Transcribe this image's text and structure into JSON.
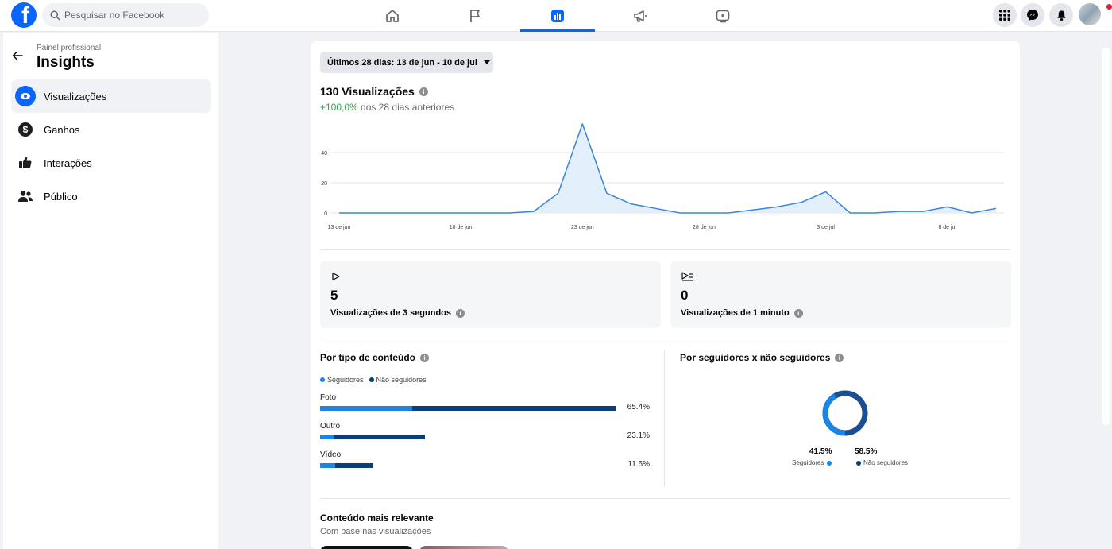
{
  "topbar": {
    "search_placeholder": "Pesquisar no Facebook",
    "tabs": [
      {
        "icon": "home-icon"
      },
      {
        "icon": "flag-icon"
      },
      {
        "icon": "insights-icon",
        "active": true
      },
      {
        "icon": "megaphone-icon"
      },
      {
        "icon": "video-icon"
      }
    ],
    "right": [
      "menu-grid-icon",
      "messenger-icon",
      "bell-icon",
      "avatar"
    ]
  },
  "sidebar": {
    "kicker": "Painel profissional",
    "title": "Insights",
    "items": [
      {
        "label": "Visualizações",
        "icon": "eye-icon",
        "active": true
      },
      {
        "label": "Ganhos",
        "icon": "dollar-icon"
      },
      {
        "label": "Interações",
        "icon": "thumbs-up-icon"
      },
      {
        "label": "Público",
        "icon": "people-icon"
      }
    ]
  },
  "main": {
    "range_label": "Últimos 28 dias: 13 de jun - 10 de jul",
    "views_title": "130 Visualizações",
    "views_change": "+100,0%",
    "views_change_suffix": " dos 28 dias anteriores",
    "stats": [
      {
        "value": "5",
        "label": "Visualizações de 3 segundos",
        "icon": "play-icon"
      },
      {
        "value": "0",
        "label": "Visualizações de 1 minuto",
        "icon": "play-list-icon"
      }
    ],
    "content_type": {
      "title": "Por tipo de conteúdo",
      "legend": [
        "Seguidores",
        "Não seguidores"
      ],
      "rows": [
        {
          "label": "Foto",
          "pct": "65.4%",
          "total": 0.654,
          "followers_share": 0.31
        },
        {
          "label": "Outro",
          "pct": "23.1%",
          "total": 0.231,
          "followers_share": 0.14
        },
        {
          "label": "Vídeo",
          "pct": "11.6%",
          "total": 0.116,
          "followers_share": 0.28
        }
      ]
    },
    "followers": {
      "title": "Por seguidores x não seguidores",
      "followers_pct": "41.5%",
      "non_followers_pct": "58.5%",
      "followers_label": "Seguidores",
      "non_followers_label": "Não seguidores"
    },
    "relevant": {
      "title": "Conteúdo mais relevante",
      "subtitle": "Com base nas visualizações"
    },
    "colors": {
      "followers": "#1b84e7",
      "non_followers": "#0a3d7a",
      "line": "#3a86d6",
      "fill": "#e3effb"
    }
  },
  "chart_data": {
    "type": "area",
    "x_tick_labels": [
      "13 de jun",
      "18 de jun",
      "23 de jun",
      "28 de jun",
      "3 de jul",
      "8 de jul"
    ],
    "y_ticks": [
      0,
      20,
      40
    ],
    "ylim": [
      0,
      60
    ],
    "x": [
      "13 de jun",
      "14 de jun",
      "15 de jun",
      "16 de jun",
      "17 de jun",
      "18 de jun",
      "19 de jun",
      "20 de jun",
      "21 de jun",
      "22 de jun",
      "23 de jun",
      "24 de jun",
      "25 de jun",
      "26 de jun",
      "27 de jun",
      "28 de jun",
      "29 de jun",
      "30 de jun",
      "1 de jul",
      "2 de jul",
      "3 de jul",
      "4 de jul",
      "5 de jul",
      "6 de jul",
      "7 de jul",
      "8 de jul",
      "9 de jul",
      "10 de jul"
    ],
    "values": [
      0,
      0,
      0,
      0,
      0,
      0,
      0,
      0,
      1,
      13,
      59,
      13,
      6,
      3,
      0,
      0,
      0,
      2,
      4,
      7,
      14,
      0,
      0,
      1,
      1,
      4,
      0,
      3
    ]
  }
}
